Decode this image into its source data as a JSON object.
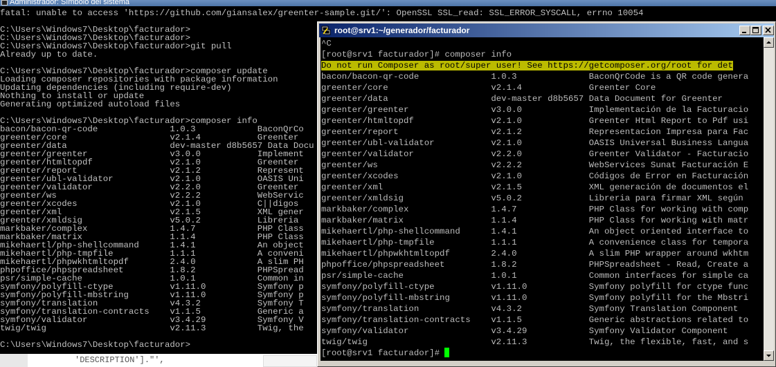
{
  "cmd": {
    "title": "Administrador: Símbolo del sistema",
    "lines": [
      "fatal: unable to access 'https://github.com/giansalex/greenter-sample.git/': OpenSSL SSL_read: SSL_ERROR_SYSCALL, errno 10054",
      "",
      "C:\\Users\\Windows7\\Desktop\\facturador>",
      "C:\\Users\\Windows7\\Desktop\\facturador>",
      "C:\\Users\\Windows7\\Desktop\\facturador>git pull",
      "Already up to date.",
      "",
      "C:\\Users\\Windows7\\Desktop\\facturador>composer update",
      "Loading composer repositories with package information",
      "Updating dependencies (including require-dev)",
      "Nothing to install or update",
      "Generating optimized autoload files",
      "",
      "C:\\Users\\Windows7\\Desktop\\facturador>composer info",
      "bacon/bacon-qr-code              1.0.3            BaconQrCo",
      "greenter/core                    v2.1.4           Greenter ",
      "greenter/data                    dev-master d8b5657 Data Docu",
      "greenter/greenter                v3.0.0           Implement",
      "greenter/htmltopdf               v2.1.0           Greenter ",
      "greenter/report                  v2.1.2           Represent",
      "greenter/ubl-validator           v2.1.0           OASIS Uni",
      "greenter/validator               v2.2.0           Greenter ",
      "greenter/ws                      v2.2.2           WebServic",
      "greenter/xcodes                  v2.1.0           C||digos ",
      "greenter/xml                     v2.1.5           XML gener",
      "greenter/xmldsig                 v5.0.2           Libreria ",
      "markbaker/complex                1.4.7            PHP Class",
      "markbaker/matrix                 1.1.4            PHP Class",
      "mikehaertl/php-shellcommand      1.4.1            An object",
      "mikehaertl/php-tmpfile           1.1.1            A conveni",
      "mikehaertl/phpwkhtmltopdf        2.4.0            A slim PH",
      "phpoffice/phpspreadsheet         1.8.2            PHPSpread",
      "psr/simple-cache                 1.0.1            Common in",
      "symfony/polyfill-ctype           v1.11.0          Symfony p",
      "symfony/polyfill-mbstring        v1.11.0          Symfony p",
      "symfony/translation              v4.3.2           Symfony T",
      "symfony/translation-contracts    v1.1.5           Generic a",
      "symfony/validator                v3.4.29          Symfony V",
      "twig/twig                        v2.11.3          Twig, the",
      "",
      "C:\\Users\\Windows7\\Desktop\\facturador>"
    ]
  },
  "editor": {
    "code": "'DESCRIPTION'].\"',"
  },
  "putty": {
    "title": "root@srv1:~/generador/facturador",
    "lines": [
      "^C",
      "[root@srv1 facturador]# composer info",
      "Do not run Composer as root/super user! See https://getcomposer.org/root for det",
      "bacon/bacon-qr-code              1.0.3              BaconQrCode is a QR code genera",
      "greenter/core                    v2.1.4             Greenter Core",
      "greenter/data                    dev-master d8b5657 Data Document for Greenter",
      "greenter/greenter                v3.0.0             Implementación de la Facturacio",
      "greenter/htmltopdf               v2.1.0             Greenter Html Report to Pdf usi",
      "greenter/report                  v2.1.2             Representacion Impresa para Fac",
      "greenter/ubl-validator           v2.1.0             OASIS Universal Business Langua",
      "greenter/validator               v2.2.0             Greenter Validator - Facturacio",
      "greenter/ws                      v2.2.2             WebServices Sunat Facturación E",
      "greenter/xcodes                  v2.1.0             Códigos de Error en Facturación",
      "greenter/xml                     v2.1.5             XML generación de documentos el",
      "greenter/xmldsig                 v5.0.2             Libreria para firmar XML según ",
      "markbaker/complex                1.4.7              PHP Class for working with comp",
      "markbaker/matrix                 1.1.4              PHP Class for working with matr",
      "mikehaertl/php-shellcommand      1.4.1              An object oriented interface to",
      "mikehaertl/php-tmpfile           1.1.1              A convenience class for tempora",
      "mikehaertl/phpwkhtmltopdf        2.4.0              A slim PHP wrapper around wkhtm",
      "phpoffice/phpspreadsheet         1.8.2              PHPSpreadsheet - Read, Create a",
      "psr/simple-cache                 1.0.1              Common interfaces for simple ca",
      "symfony/polyfill-ctype           v1.11.0            Symfony polyfill for ctype func",
      "symfony/polyfill-mbstring        v1.11.0            Symfony polyfill for the Mbstri",
      "symfony/translation              v4.3.2             Symfony Translation Component",
      "symfony/translation-contracts    v1.1.5             Generic abstractions related to",
      "symfony/validator                v3.4.29            Symfony Validator Component",
      "twig/twig                        v2.11.3            Twig, the flexible, fast, and s"
    ],
    "prompt": "[root@srv1 facturador]# ",
    "warning_line_index": 2,
    "colors": {
      "warning_bg": "#bbbb00",
      "cursor": "#00ff00",
      "titlebar_start": "#0a246a",
      "titlebar_end": "#a6caf0"
    },
    "controls": {
      "minimize_icon": "minimize-icon",
      "maximize_icon": "maximize-icon",
      "close_icon": "close-icon"
    }
  }
}
